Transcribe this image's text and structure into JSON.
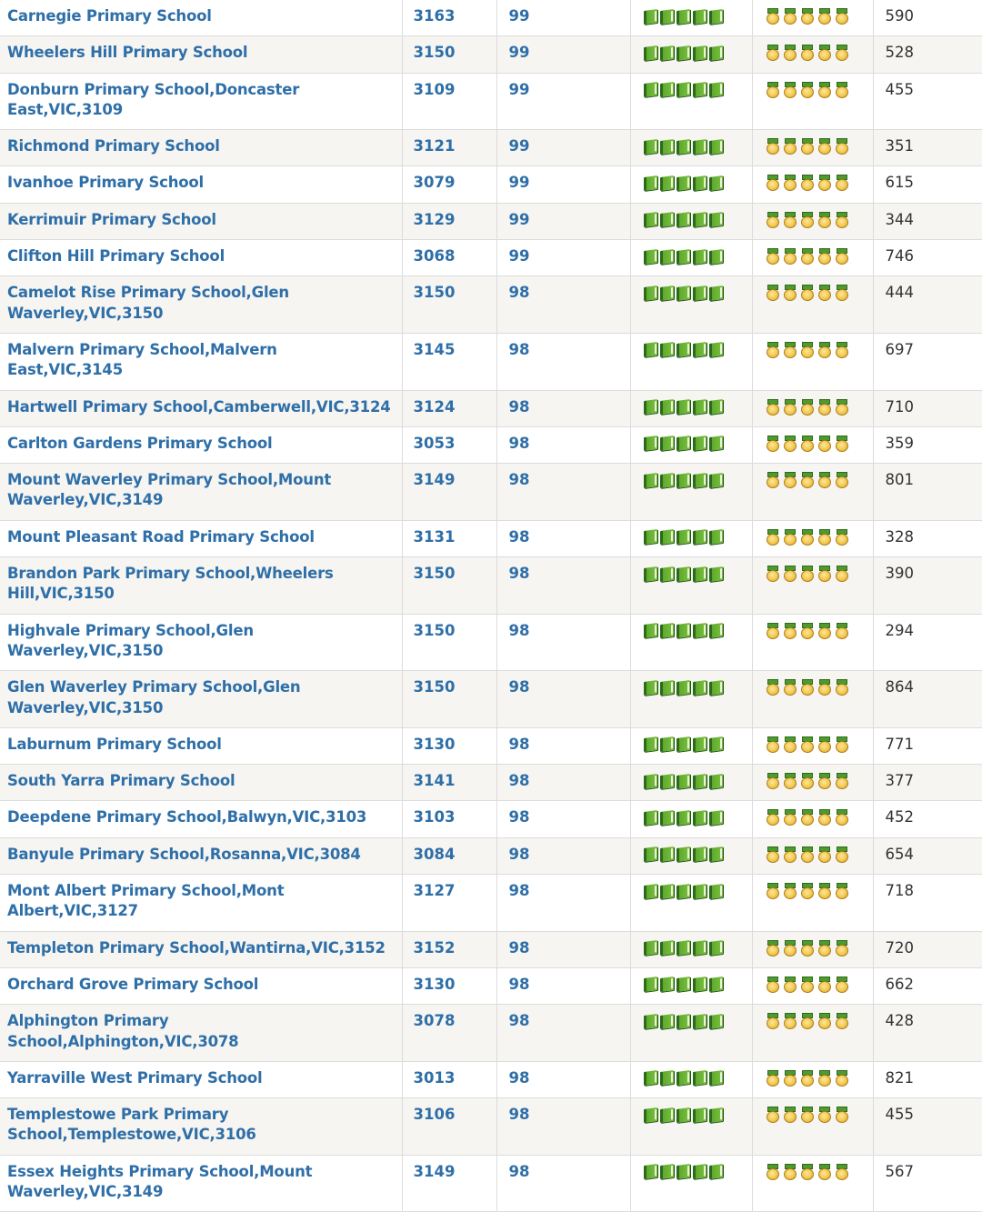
{
  "rows": [
    {
      "name": "Carnegie Primary School",
      "postcode": "3163",
      "score": "99",
      "enrolment": "590"
    },
    {
      "name": "Wheelers Hill Primary School",
      "postcode": "3150",
      "score": "99",
      "enrolment": "528"
    },
    {
      "name": "Donburn Primary School,Doncaster East,VIC,3109",
      "postcode": "3109",
      "score": "99",
      "enrolment": "455"
    },
    {
      "name": "Richmond Primary School",
      "postcode": "3121",
      "score": "99",
      "enrolment": "351"
    },
    {
      "name": "Ivanhoe Primary School",
      "postcode": "3079",
      "score": "99",
      "enrolment": "615"
    },
    {
      "name": "Kerrimuir Primary School",
      "postcode": "3129",
      "score": "99",
      "enrolment": "344"
    },
    {
      "name": "Clifton Hill Primary School",
      "postcode": "3068",
      "score": "99",
      "enrolment": "746"
    },
    {
      "name": "Camelot Rise Primary School,Glen Waverley,VIC,3150",
      "postcode": "3150",
      "score": "98",
      "enrolment": "444"
    },
    {
      "name": "Malvern Primary School,Malvern East,VIC,3145",
      "postcode": "3145",
      "score": "98",
      "enrolment": "697"
    },
    {
      "name": "Hartwell Primary School,Camberwell,VIC,3124",
      "postcode": "3124",
      "score": "98",
      "enrolment": "710"
    },
    {
      "name": "Carlton Gardens Primary School",
      "postcode": "3053",
      "score": "98",
      "enrolment": "359"
    },
    {
      "name": "Mount Waverley Primary School,Mount Waverley,VIC,3149",
      "postcode": "3149",
      "score": "98",
      "enrolment": "801"
    },
    {
      "name": "Mount Pleasant Road Primary School",
      "postcode": "3131",
      "score": "98",
      "enrolment": "328"
    },
    {
      "name": "Brandon Park Primary School,Wheelers Hill,VIC,3150",
      "postcode": "3150",
      "score": "98",
      "enrolment": "390"
    },
    {
      "name": "Highvale Primary School,Glen Waverley,VIC,3150",
      "postcode": "3150",
      "score": "98",
      "enrolment": "294"
    },
    {
      "name": "Glen Waverley Primary School,Glen Waverley,VIC,3150",
      "postcode": "3150",
      "score": "98",
      "enrolment": "864"
    },
    {
      "name": "Laburnum Primary School",
      "postcode": "3130",
      "score": "98",
      "enrolment": "771"
    },
    {
      "name": "South Yarra Primary School",
      "postcode": "3141",
      "score": "98",
      "enrolment": "377"
    },
    {
      "name": "Deepdene Primary School,Balwyn,VIC,3103",
      "postcode": "3103",
      "score": "98",
      "enrolment": "452"
    },
    {
      "name": "Banyule Primary School,Rosanna,VIC,3084",
      "postcode": "3084",
      "score": "98",
      "enrolment": "654"
    },
    {
      "name": "Mont Albert Primary School,Mont Albert,VIC,3127",
      "postcode": "3127",
      "score": "98",
      "enrolment": "718"
    },
    {
      "name": "Templeton Primary School,Wantirna,VIC,3152",
      "postcode": "3152",
      "score": "98",
      "enrolment": "720"
    },
    {
      "name": "Orchard Grove Primary School",
      "postcode": "3130",
      "score": "98",
      "enrolment": "662"
    },
    {
      "name": "Alphington Primary School,Alphington,VIC,3078",
      "postcode": "3078",
      "score": "98",
      "enrolment": "428"
    },
    {
      "name": "Yarraville West Primary School",
      "postcode": "3013",
      "score": "98",
      "enrolment": "821"
    },
    {
      "name": "Templestowe Park Primary School,Templestowe,VIC,3106",
      "postcode": "3106",
      "score": "98",
      "enrolment": "455"
    },
    {
      "name": "Essex Heights Primary School,Mount Waverley,VIC,3149",
      "postcode": "3149",
      "score": "98",
      "enrolment": "567"
    }
  ],
  "ratings": {
    "books": {
      "icon": "book-icon",
      "count": 5,
      "max": 5,
      "color": "#5faa2e"
    },
    "medals": {
      "icon": "medal-icon",
      "count": 5,
      "max": 5,
      "color": "#f3c94d"
    }
  }
}
